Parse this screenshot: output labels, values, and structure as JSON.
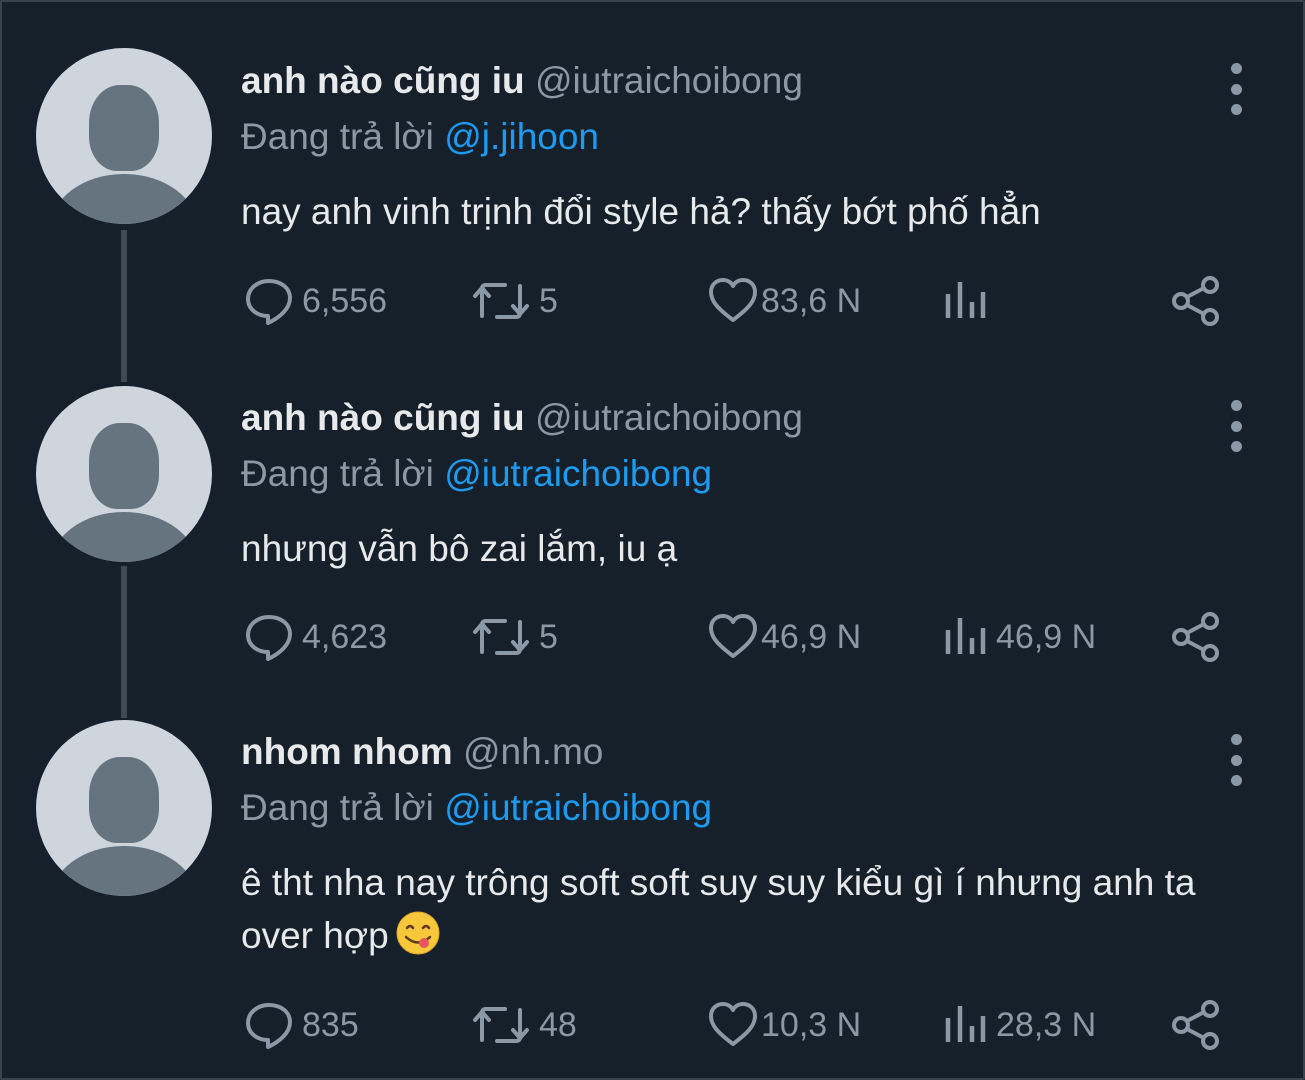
{
  "tweets": [
    {
      "name": "anh nào cũng iu",
      "handle": "@iutraichoibong",
      "reply_prefix": "Đang trả lời",
      "reply_to": "@j.jihoon",
      "text": "nay anh vinh trịnh đổi style hả? thấy bớt phố hẳn",
      "replies": "6,556",
      "retweets": "5",
      "likes": "83,6 N",
      "views": ""
    },
    {
      "name": "anh nào cũng iu",
      "handle": "@iutraichoibong",
      "reply_prefix": "Đang trả lời",
      "reply_to": "@iutraichoibong",
      "text": "nhưng vẫn bô zai lắm, iu ạ",
      "replies": "4,623",
      "retweets": "5",
      "likes": "46,9 N",
      "views": "46,9 N"
    },
    {
      "name": "nhom nhom",
      "handle": "@nh.mo",
      "reply_prefix": "Đang trả lời",
      "reply_to": "@iutraichoibong",
      "text": "ê tht nha nay trông soft soft suy suy kiểu gì í nhưng anh ta over hợp",
      "emoji": "😋",
      "replies": "835",
      "retweets": "48",
      "likes": "10,3 N",
      "views": "28,3 N"
    }
  ],
  "icons": {
    "reply": "speech-bubble-icon",
    "retweet": "retweet-icon",
    "like": "heart-icon",
    "views": "bar-chart-icon",
    "share": "share-icon",
    "more": "vertical-dots-icon"
  },
  "colors": {
    "background": "#15202b",
    "text": "#e7e9ea",
    "secondary": "#8b98a5",
    "mention": "#1d9bf0"
  }
}
